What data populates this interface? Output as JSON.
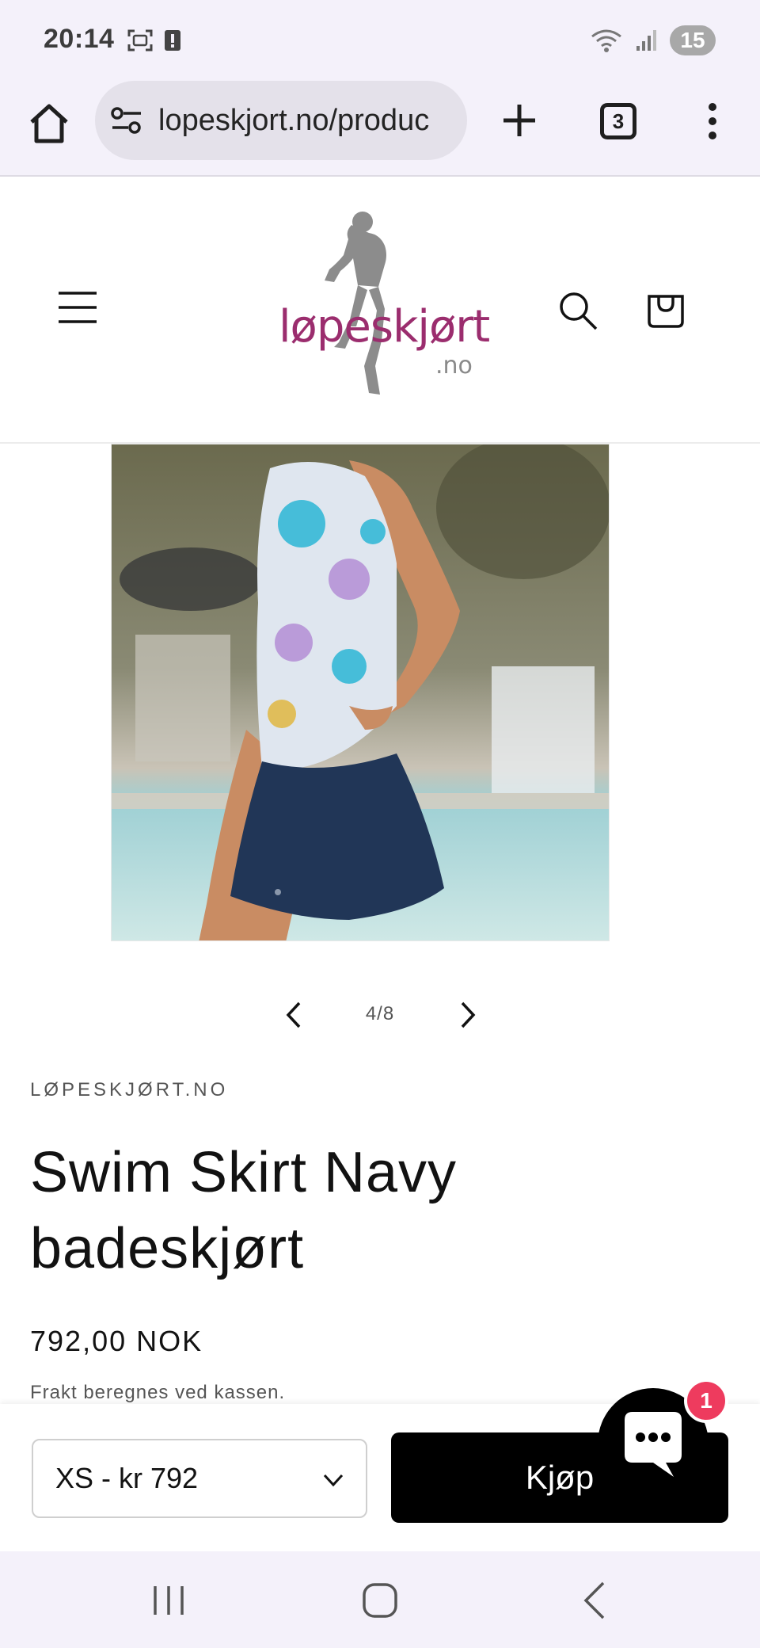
{
  "status_bar": {
    "time": "20:14",
    "battery_level": "15",
    "icons": [
      "screenshot-icon",
      "alert-icon",
      "wifi-icon",
      "signal-icon",
      "battery-icon"
    ]
  },
  "browser": {
    "url": "lopeskjort.no/produc",
    "tab_count": "3",
    "icons": [
      "home-icon",
      "site-settings-icon",
      "new-tab-icon",
      "tabs-icon",
      "more-icon"
    ]
  },
  "site": {
    "logo_text": "løpeskjørt",
    "logo_sub": ".no",
    "icons": [
      "menu-icon",
      "search-icon",
      "cart-icon"
    ]
  },
  "gallery": {
    "counter": "4/8"
  },
  "product": {
    "vendor": "LØPESKJØRT.NO",
    "title": "Swim Skirt Navy badeskjørt",
    "price": "792,00 NOK",
    "shipping_note": "Frakt beregnes ved kassen."
  },
  "purchase": {
    "variant_selected": "XS - kr 792",
    "buy_label": "Kjøp"
  },
  "chat": {
    "badge_count": "1"
  },
  "colors": {
    "brand_magenta": "#9b2d6e",
    "chat_badge": "#ee3b5e",
    "buy_button": "#000000",
    "browser_chrome": "#f4f1fa"
  }
}
